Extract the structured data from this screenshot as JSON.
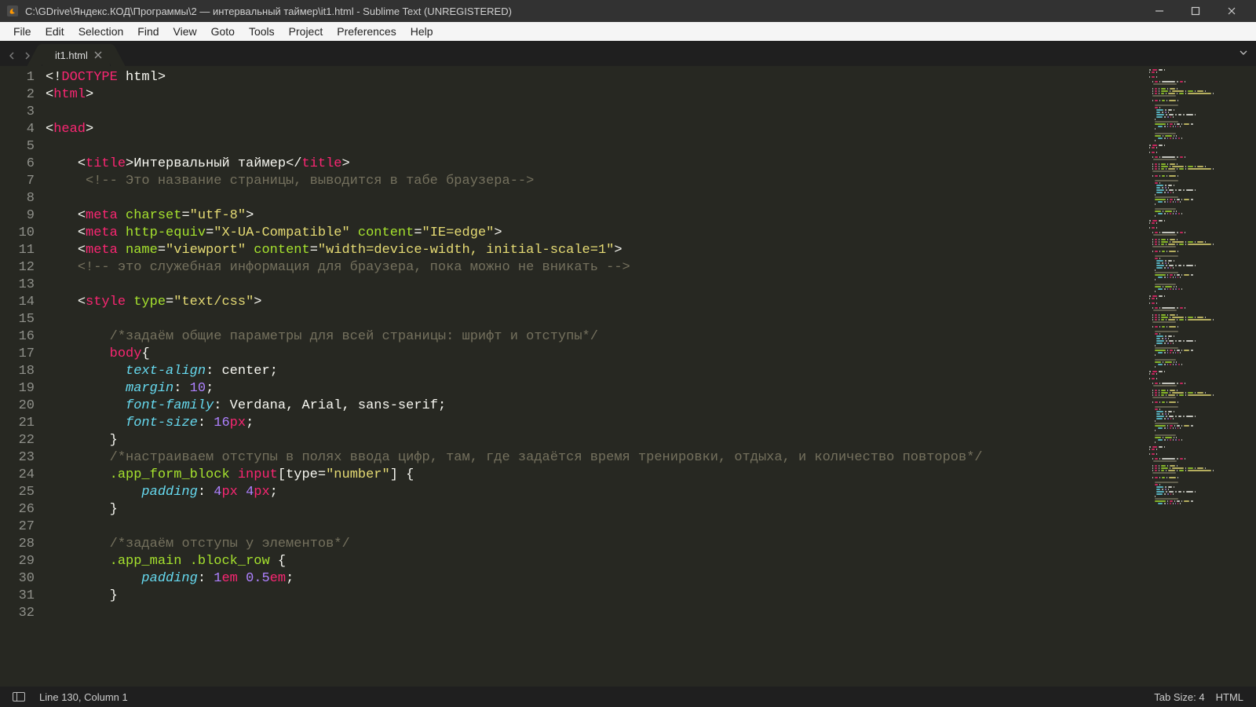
{
  "window": {
    "title": "C:\\GDrive\\Яндекс.КОД\\Программы\\2 — интервальный таймер\\it1.html - Sublime Text (UNREGISTERED)"
  },
  "menu": [
    "File",
    "Edit",
    "Selection",
    "Find",
    "View",
    "Goto",
    "Tools",
    "Project",
    "Preferences",
    "Help"
  ],
  "tabs": [
    {
      "label": "it1.html",
      "active": true
    }
  ],
  "code": {
    "lines": [
      [
        [
          "pun",
          "<!"
        ],
        [
          "tag",
          "DOCTYPE"
        ],
        [
          "txt",
          " html"
        ],
        [
          "pun",
          ">"
        ]
      ],
      [
        [
          "pun",
          "<"
        ],
        [
          "tag",
          "html"
        ],
        [
          "pun",
          ">"
        ]
      ],
      [
        [
          "txt",
          ""
        ]
      ],
      [
        [
          "pun",
          "<"
        ],
        [
          "tag",
          "head"
        ],
        [
          "pun",
          ">"
        ]
      ],
      [
        [
          "txt",
          ""
        ]
      ],
      [
        [
          "txt",
          "    "
        ],
        [
          "pun",
          "<"
        ],
        [
          "tag",
          "title"
        ],
        [
          "pun",
          ">"
        ],
        [
          "txt",
          "Интервальный таймер"
        ],
        [
          "pun",
          "</"
        ],
        [
          "tag",
          "title"
        ],
        [
          "pun",
          ">"
        ]
      ],
      [
        [
          "txt",
          "     "
        ],
        [
          "com",
          "<!-- Это название страницы, выводится в табе браузера-->"
        ]
      ],
      [
        [
          "txt",
          ""
        ]
      ],
      [
        [
          "txt",
          "    "
        ],
        [
          "pun",
          "<"
        ],
        [
          "tag",
          "meta"
        ],
        [
          "txt",
          " "
        ],
        [
          "attr",
          "charset"
        ],
        [
          "pun",
          "="
        ],
        [
          "str",
          "\"utf-8\""
        ],
        [
          "pun",
          ">"
        ]
      ],
      [
        [
          "txt",
          "    "
        ],
        [
          "pun",
          "<"
        ],
        [
          "tag",
          "meta"
        ],
        [
          "txt",
          " "
        ],
        [
          "attr",
          "http-equiv"
        ],
        [
          "pun",
          "="
        ],
        [
          "str",
          "\"X-UA-Compatible\""
        ],
        [
          "txt",
          " "
        ],
        [
          "attr",
          "content"
        ],
        [
          "pun",
          "="
        ],
        [
          "str",
          "\"IE=edge\""
        ],
        [
          "pun",
          ">"
        ]
      ],
      [
        [
          "txt",
          "    "
        ],
        [
          "pun",
          "<"
        ],
        [
          "tag",
          "meta"
        ],
        [
          "txt",
          " "
        ],
        [
          "attr",
          "name"
        ],
        [
          "pun",
          "="
        ],
        [
          "str",
          "\"viewport\""
        ],
        [
          "txt",
          " "
        ],
        [
          "attr",
          "content"
        ],
        [
          "pun",
          "="
        ],
        [
          "str",
          "\"width=device-width, initial-scale=1\""
        ],
        [
          "pun",
          ">"
        ]
      ],
      [
        [
          "txt",
          "    "
        ],
        [
          "com",
          "<!-- это служебная информация для браузера, пока можно не вникать -->"
        ]
      ],
      [
        [
          "txt",
          ""
        ]
      ],
      [
        [
          "txt",
          "    "
        ],
        [
          "pun",
          "<"
        ],
        [
          "tag",
          "style"
        ],
        [
          "txt",
          " "
        ],
        [
          "attr",
          "type"
        ],
        [
          "pun",
          "="
        ],
        [
          "str",
          "\"text/css\""
        ],
        [
          "pun",
          ">"
        ]
      ],
      [
        [
          "txt",
          ""
        ]
      ],
      [
        [
          "txt",
          "        "
        ],
        [
          "com",
          "/*задаём общие параметры для всей страницы: шрифт и отступы*/"
        ]
      ],
      [
        [
          "txt",
          "        "
        ],
        [
          "seltag",
          "body"
        ],
        [
          "pun",
          "{"
        ]
      ],
      [
        [
          "txt",
          "          "
        ],
        [
          "prop",
          "text-align"
        ],
        [
          "pun",
          ": "
        ],
        [
          "txt",
          "center"
        ],
        [
          "pun",
          ";"
        ]
      ],
      [
        [
          "txt",
          "          "
        ],
        [
          "prop",
          "margin"
        ],
        [
          "pun",
          ": "
        ],
        [
          "num",
          "10"
        ],
        [
          "pun",
          ";"
        ]
      ],
      [
        [
          "txt",
          "          "
        ],
        [
          "prop",
          "font-family"
        ],
        [
          "pun",
          ": "
        ],
        [
          "txt",
          "Verdana"
        ],
        [
          "pun",
          ", "
        ],
        [
          "txt",
          "Arial"
        ],
        [
          "pun",
          ", "
        ],
        [
          "txt",
          "sans-serif"
        ],
        [
          "pun",
          ";"
        ]
      ],
      [
        [
          "txt",
          "          "
        ],
        [
          "prop",
          "font-size"
        ],
        [
          "pun",
          ": "
        ],
        [
          "num",
          "16"
        ],
        [
          "unit",
          "px"
        ],
        [
          "pun",
          ";"
        ]
      ],
      [
        [
          "txt",
          "        "
        ],
        [
          "pun",
          "}"
        ]
      ],
      [
        [
          "txt",
          "        "
        ],
        [
          "com",
          "/*настраиваем отступы в полях ввода цифр, там, где задаётся время тренировки, отдыха, и количество повторов*/"
        ]
      ],
      [
        [
          "txt",
          "        "
        ],
        [
          "sel",
          ".app_form_block"
        ],
        [
          "txt",
          " "
        ],
        [
          "seltag",
          "input"
        ],
        [
          "pun",
          "["
        ],
        [
          "txt",
          "type"
        ],
        [
          "pun",
          "="
        ],
        [
          "str",
          "\"number\""
        ],
        [
          "pun",
          "] {"
        ]
      ],
      [
        [
          "txt",
          "            "
        ],
        [
          "prop",
          "padding"
        ],
        [
          "pun",
          ": "
        ],
        [
          "num",
          "4"
        ],
        [
          "unit",
          "px"
        ],
        [
          "txt",
          " "
        ],
        [
          "num",
          "4"
        ],
        [
          "unit",
          "px"
        ],
        [
          "pun",
          ";"
        ]
      ],
      [
        [
          "txt",
          "        "
        ],
        [
          "pun",
          "}"
        ]
      ],
      [
        [
          "txt",
          ""
        ]
      ],
      [
        [
          "txt",
          "        "
        ],
        [
          "com",
          "/*задаём отступы у элементов*/"
        ]
      ],
      [
        [
          "txt",
          "        "
        ],
        [
          "sel",
          ".app_main"
        ],
        [
          "txt",
          " "
        ],
        [
          "sel",
          ".block_row"
        ],
        [
          "txt",
          " "
        ],
        [
          "pun",
          "{"
        ]
      ],
      [
        [
          "txt",
          "            "
        ],
        [
          "prop",
          "padding"
        ],
        [
          "pun",
          ": "
        ],
        [
          "num",
          "1"
        ],
        [
          "unit",
          "em"
        ],
        [
          "txt",
          " "
        ],
        [
          "num",
          "0.5"
        ],
        [
          "unit",
          "em"
        ],
        [
          "pun",
          ";"
        ]
      ],
      [
        [
          "txt",
          "        "
        ],
        [
          "pun",
          "}"
        ]
      ],
      [
        [
          "txt",
          ""
        ]
      ]
    ],
    "first_line_number": 1
  },
  "status": {
    "cursor": "Line 130, Column 1",
    "tab_size": "Tab Size: 4",
    "syntax": "HTML"
  },
  "colors": {
    "pun": "#f8f8f2",
    "tag": "#f92672",
    "attr": "#a6e22e",
    "str": "#e6db74",
    "num": "#ae81ff",
    "unit": "#f92672",
    "txt": "#f8f8f2",
    "com": "#75715e",
    "prop": "#66d9ef",
    "sel": "#a6e22e",
    "seltag": "#f92672"
  }
}
